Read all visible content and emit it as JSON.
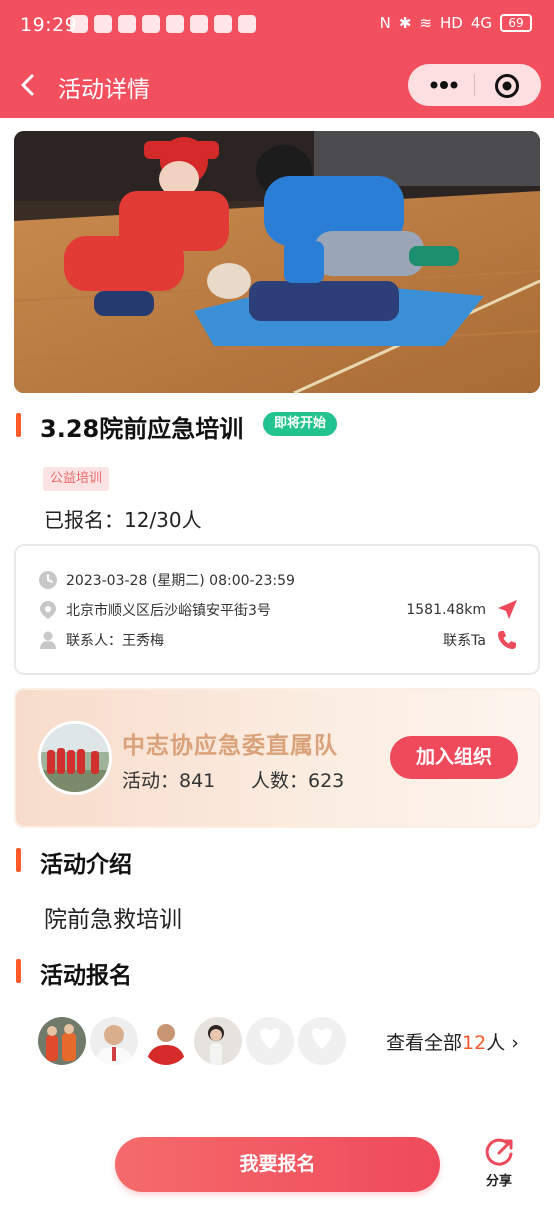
{
  "status_bar": {
    "time": "19:29",
    "network": "HD",
    "signal": "4G",
    "battery": "69"
  },
  "nav": {
    "title": "活动详情"
  },
  "activity": {
    "title": "3.28院前应急培训",
    "status_badge": "即将开始",
    "tag": "公益培训",
    "registered": "已报名：12/30人"
  },
  "info": {
    "datetime": "2023-03-28 (星期二) 08:00-23:59",
    "address": "北京市顺义区后沙峪镇安平街3号",
    "distance": "1581.48km",
    "contact": "联系人：王秀梅",
    "contact_action": "联系Ta"
  },
  "org": {
    "name": "中志协应急委直属队",
    "activities": "活动：841",
    "members": "人数：623",
    "join_label": "加入组织"
  },
  "intro": {
    "heading": "活动介绍",
    "text": "院前急救培训"
  },
  "signup": {
    "heading": "活动报名",
    "view_all_prefix": "查看全部",
    "view_all_count": "12",
    "view_all_suffix": "人",
    "chevron": "›"
  },
  "bottom": {
    "signup_label": "我要报名",
    "share_label": "分享"
  },
  "colors": {
    "brand": "#f3505f",
    "accent": "#ff5a28",
    "badge_green": "#22c38e",
    "org_gold": "#d9a27a"
  }
}
